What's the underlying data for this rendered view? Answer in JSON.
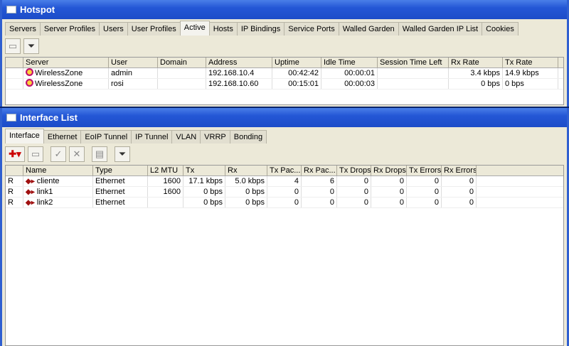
{
  "hotspot": {
    "title": "Hotspot",
    "tabs": [
      "Servers",
      "Server Profiles",
      "Users",
      "User Profiles",
      "Active",
      "Hosts",
      "IP Bindings",
      "Service Ports",
      "Walled Garden",
      "Walled Garden IP List",
      "Cookies"
    ],
    "active_tab": "Active",
    "columns": [
      "",
      "Server",
      "User",
      "Domain",
      "Address",
      "Uptime",
      "Idle Time",
      "Session Time Left",
      "Rx Rate",
      "Tx Rate"
    ],
    "rows": [
      [
        "",
        "WirelessZone",
        "admin",
        "",
        "192.168.10.4",
        "00:42:42",
        "00:00:01",
        "",
        "3.4 kbps",
        "14.9 kbps"
      ],
      [
        "",
        "WirelessZone",
        "rosi",
        "",
        "192.168.10.60",
        "00:15:01",
        "00:00:03",
        "",
        "0 bps",
        "0 bps"
      ]
    ]
  },
  "interfaces": {
    "title": "Interface List",
    "tabs": [
      "Interface",
      "Ethernet",
      "EoIP Tunnel",
      "IP Tunnel",
      "VLAN",
      "VRRP",
      "Bonding"
    ],
    "active_tab": "Interface",
    "columns": [
      "",
      "Name",
      "Type",
      "L2 MTU",
      "Tx",
      "Rx",
      "Tx Pac...",
      "Rx Pac...",
      "Tx Drops",
      "Rx Drops",
      "Tx Errors",
      "Rx Errors"
    ],
    "rows": [
      [
        "R",
        "cliente",
        "Ethernet",
        "1600",
        "17.1 kbps",
        "5.0 kbps",
        "4",
        "6",
        "0",
        "0",
        "0",
        "0"
      ],
      [
        "R",
        "link1",
        "Ethernet",
        "1600",
        "0 bps",
        "0 bps",
        "0",
        "0",
        "0",
        "0",
        "0",
        "0"
      ],
      [
        "R",
        "link2",
        "Ethernet",
        "",
        "0 bps",
        "0 bps",
        "0",
        "0",
        "0",
        "0",
        "0",
        "0"
      ]
    ]
  }
}
